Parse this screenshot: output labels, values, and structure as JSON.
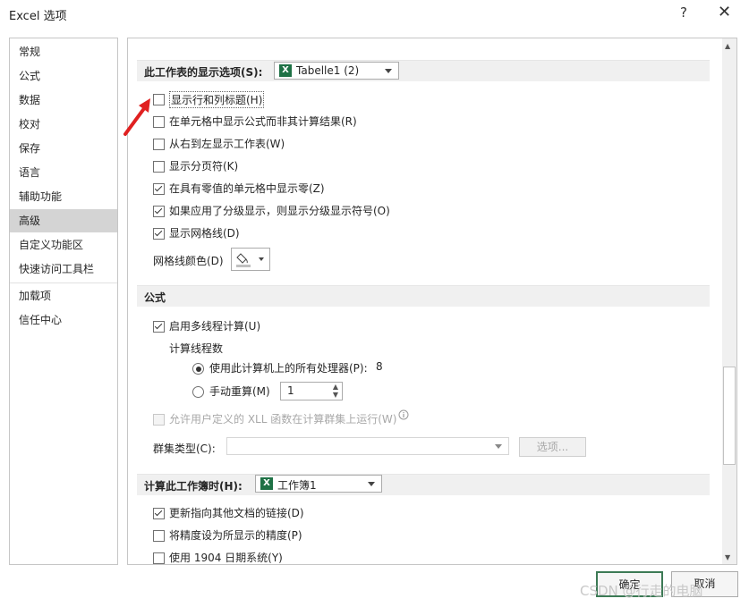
{
  "window": {
    "title": "Excel 选项",
    "help": "?",
    "close": "✕"
  },
  "nav": {
    "items": [
      "常规",
      "公式",
      "数据",
      "校对",
      "保存",
      "语言",
      "辅助功能",
      "高级",
      "自定义功能区",
      "快速访问工具栏",
      "加载项",
      "信任中心"
    ],
    "active": "高级"
  },
  "sheet_display": {
    "label": "此工作表的显示选项(S):",
    "selected": "Tabelle1 (2)",
    "options": [
      {
        "label": "显示行和列标题(H)",
        "checked": false
      },
      {
        "label": "在单元格中显示公式而非其计算结果(R)",
        "checked": false
      },
      {
        "label": "从右到左显示工作表(W)",
        "checked": false
      },
      {
        "label": "显示分页符(K)",
        "checked": false
      },
      {
        "label": "在具有零值的单元格中显示零(Z)",
        "checked": true
      },
      {
        "label": "如果应用了分级显示，则显示分级显示符号(O)",
        "checked": true
      },
      {
        "label": "显示网格线(D)",
        "checked": true
      }
    ],
    "gridline_color_label": "网格线颜色(D)"
  },
  "formulas": {
    "label": "公式",
    "multithread": "启用多线程计算(U)",
    "thread_count_label": "计算线程数",
    "use_all": "使用此计算机上的所有处理器(P):",
    "processors": "8",
    "manual": "手动重算(M)",
    "manual_value": "1",
    "xll": "允许用户定义的 XLL 函数在计算群集上运行(W)",
    "cluster_type": "群集类型(C):",
    "options_button": "选项..."
  },
  "workbook_calc": {
    "label": "计算此工作簿时(H):",
    "selected": "工作簿1",
    "options": [
      {
        "label": "更新指向其他文档的链接(D)",
        "checked": true
      },
      {
        "label": "将精度设为所显示的精度(P)",
        "checked": false
      },
      {
        "label": "使用 1904 日期系统(Y)",
        "checked": false
      }
    ]
  },
  "buttons": {
    "ok": "确定",
    "cancel": "取消"
  },
  "watermark": "CSDN @行走的电脑",
  "colors": {
    "active_nav": "#d4d4d4",
    "section_bg": "#f0f0f0",
    "excel_green": "#1e7145",
    "arrow": "#e02020"
  }
}
